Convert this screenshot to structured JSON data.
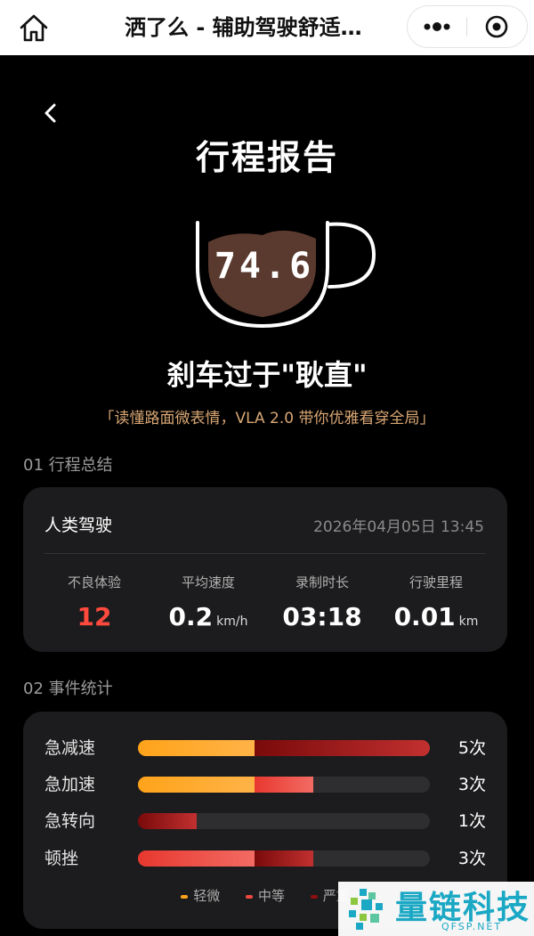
{
  "topbar": {
    "title": "洒了么 - 辅助驾驶舒适…",
    "home_icon": "home-icon",
    "more_icon": "more-dots-icon",
    "close_icon": "target-close-icon"
  },
  "header": {
    "back_icon": "chevron-left-icon",
    "title": "行程报告"
  },
  "score": {
    "value": "74.6",
    "verdict": "刹车过于\"耿直\"",
    "slogan": "「读懂路面微表情，VLA 2.0 带你优雅看穿全局」"
  },
  "summary": {
    "section_title": "01 行程总结",
    "mode": "人类驾驶",
    "datetime": "2026年04月05日 13:45",
    "stats": [
      {
        "label": "不良体验",
        "value": "12",
        "unit": ""
      },
      {
        "label": "平均速度",
        "value": "0.2",
        "unit": "km/h"
      },
      {
        "label": "录制时长",
        "value": "03:18",
        "unit": ""
      },
      {
        "label": "行驶里程",
        "value": "0.01",
        "unit": "km"
      }
    ]
  },
  "events": {
    "section_title": "02 事件统计",
    "rows": [
      {
        "name": "急减速",
        "count": "5次",
        "light": 2,
        "medium": 0,
        "severe": 3
      },
      {
        "name": "急加速",
        "count": "3次",
        "light": 2,
        "medium": 1,
        "severe": 0
      },
      {
        "name": "急转向",
        "count": "1次",
        "light": 0,
        "medium": 0,
        "severe": 1
      },
      {
        "name": "顿挫",
        "count": "3次",
        "light": 0,
        "medium": 2,
        "severe": 1
      }
    ],
    "legend": {
      "light": "轻微",
      "medium": "中等",
      "severe": "严重"
    },
    "colors": {
      "light": "#ffa31a",
      "medium": "#f04a3f",
      "severe": "#8e0f0f",
      "track": "#2e2e30"
    }
  },
  "watermark": {
    "text": "量链科技",
    "sub": "QFSP.NET"
  }
}
